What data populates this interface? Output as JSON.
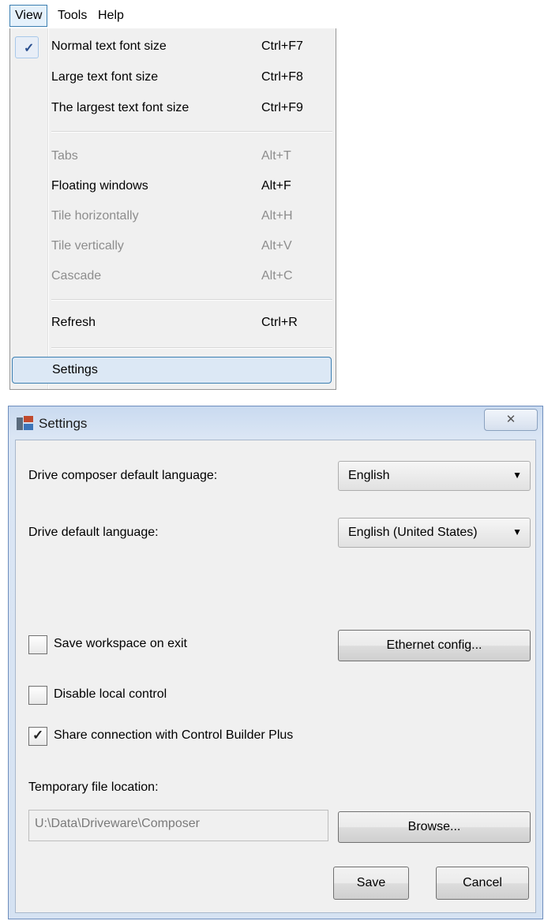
{
  "menubar": {
    "items": [
      {
        "label": "View"
      },
      {
        "label": "Tools"
      },
      {
        "label": "Help"
      }
    ]
  },
  "view_menu": {
    "items": [
      {
        "label": "Normal text font size",
        "shortcut": "Ctrl+F7",
        "checked": true,
        "enabled": true
      },
      {
        "label": "Large text font size",
        "shortcut": "Ctrl+F8",
        "enabled": true
      },
      {
        "label": "The largest text font size",
        "shortcut": "Ctrl+F9",
        "enabled": true
      },
      {
        "label": "Tabs",
        "shortcut": "Alt+T",
        "enabled": false
      },
      {
        "label": "Floating windows",
        "shortcut": "Alt+F",
        "enabled": true
      },
      {
        "label": "Tile horizontally",
        "shortcut": "Alt+H",
        "enabled": false
      },
      {
        "label": "Tile vertically",
        "shortcut": "Alt+V",
        "enabled": false
      },
      {
        "label": "Cascade",
        "shortcut": "Alt+C",
        "enabled": false
      },
      {
        "label": "Refresh",
        "shortcut": "Ctrl+R",
        "enabled": true
      },
      {
        "label": "Settings",
        "shortcut": "",
        "enabled": true,
        "highlighted": true
      }
    ],
    "check_glyph": "✓"
  },
  "settings_dialog": {
    "title": "Settings",
    "close_glyph": "✕",
    "composer_language_label": "Drive composer default language:",
    "composer_language_value": "English",
    "drive_language_label": "Drive default language:",
    "drive_language_value": "English (United States)",
    "dropdown_arrow": "▼",
    "save_workspace_label": "Save workspace on exit",
    "save_workspace_checked": false,
    "ethernet_config_label": "Ethernet config...",
    "disable_local_control_label": "Disable local control",
    "disable_local_control_checked": false,
    "share_connection_label": "Share connection with Control Builder Plus",
    "share_connection_checked": true,
    "checkbox_tick": "✓",
    "temp_location_label": "Temporary file location:",
    "temp_location_value": "U:\\Data\\Driveware\\Composer",
    "browse_label": "Browse...",
    "save_label": "Save",
    "cancel_label": "Cancel"
  }
}
